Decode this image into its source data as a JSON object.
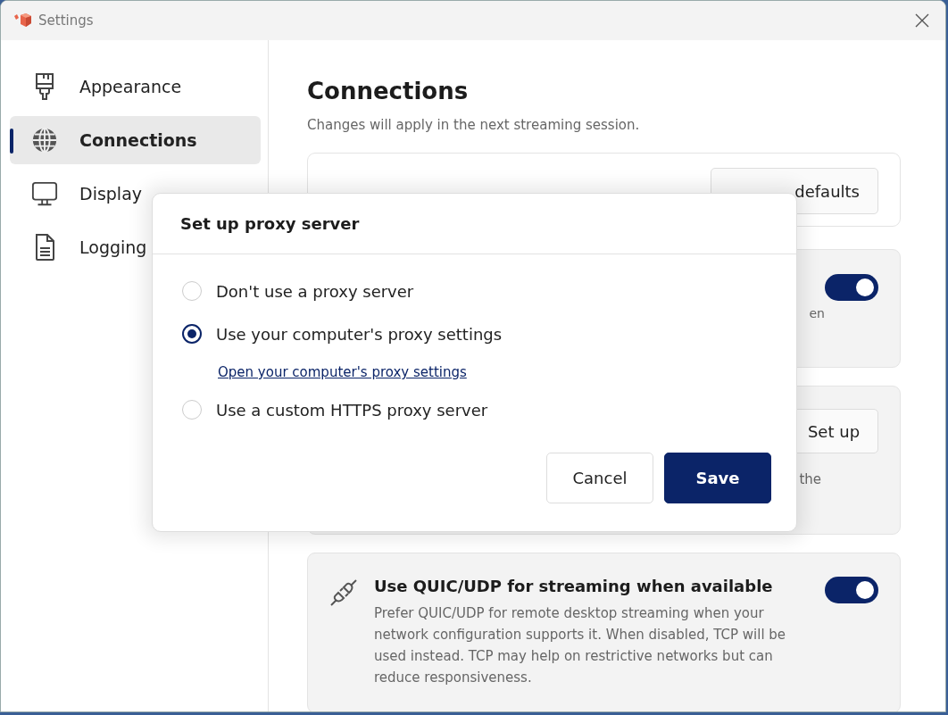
{
  "window": {
    "title": "Settings"
  },
  "sidebar": {
    "items": [
      {
        "label": "Appearance",
        "selected": false
      },
      {
        "label": "Connections",
        "selected": true
      },
      {
        "label": "Display",
        "selected": false
      },
      {
        "label": "Logging",
        "selected": false
      }
    ]
  },
  "page": {
    "title": "Connections",
    "subtitle": "Changes will apply in the next streaming session.",
    "cards": [
      {
        "kind": "button",
        "button": "defaults"
      },
      {
        "kind": "toggle",
        "on": true,
        "description": "en"
      },
      {
        "kind": "button",
        "button": "Set up",
        "description": "the"
      },
      {
        "kind": "toggle",
        "on": true,
        "title": "Use QUIC/UDP for streaming when available",
        "description": "Prefer QUIC/UDP for remote desktop streaming when your network configuration supports it. When disabled, TCP will be used instead. TCP may help on restrictive networks but can reduce responsiveness."
      }
    ]
  },
  "dialog": {
    "title": "Set up proxy server",
    "options": [
      {
        "label": "Don't use a proxy server",
        "selected": false
      },
      {
        "label": "Use your computer's proxy settings",
        "selected": true,
        "link": "Open your computer's proxy settings"
      },
      {
        "label": "Use a custom HTTPS proxy server",
        "selected": false
      }
    ],
    "buttons": [
      {
        "label": "Cancel",
        "kind": "secondary"
      },
      {
        "label": "Save",
        "kind": "primary"
      }
    ]
  }
}
